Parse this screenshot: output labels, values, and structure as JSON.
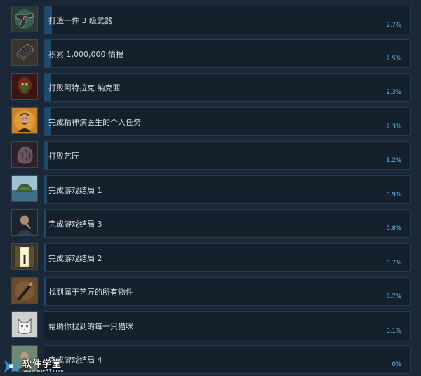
{
  "achievements": [
    {
      "name": "打造一件 3 级武器",
      "percent": "2.7%",
      "fraction": 0.027,
      "icon": "revolver-icon"
    },
    {
      "name": "积累 1,000,000 情报",
      "percent": "2.5%",
      "fraction": 0.025,
      "icon": "documents-icon"
    },
    {
      "name": "打败阿特拉克 纳克亚",
      "percent": "2.3%",
      "fraction": 0.023,
      "icon": "spider-monster-icon"
    },
    {
      "name": "完成精神病医生的个人任务",
      "percent": "2.3%",
      "fraction": 0.023,
      "icon": "doctor-portrait-icon"
    },
    {
      "name": "打败艺匠",
      "percent": "1.2%",
      "fraction": 0.012,
      "icon": "flesh-creature-icon"
    },
    {
      "name": "完成游戏结局 1",
      "percent": "0.9%",
      "fraction": 0.009,
      "icon": "island-icon"
    },
    {
      "name": "完成游戏结局 3",
      "percent": "0.8%",
      "fraction": 0.008,
      "icon": "man-portrait-icon"
    },
    {
      "name": "完成游戏结局 2",
      "percent": "0.7%",
      "fraction": 0.007,
      "icon": "doorway-light-icon"
    },
    {
      "name": "找到属于艺匠的所有物件",
      "percent": "0.7%",
      "fraction": 0.007,
      "icon": "carving-tool-icon"
    },
    {
      "name": "帮助你找到的每一只猫咪",
      "percent": "0.1%",
      "fraction": 0.001,
      "icon": "cat-icon"
    },
    {
      "name": "完成游戏结局 4",
      "percent": "0%",
      "fraction": 0.0,
      "icon": "figure-portrait-icon"
    }
  ],
  "colors": {
    "background": "#1b2838",
    "bar_background": "#14202c",
    "progress_fill": "#1f4c6e",
    "percent_text": "#66c0f4",
    "name_text": "#d6dbe0"
  },
  "watermark": {
    "title": "软件学堂",
    "url": "www.xue51.com"
  }
}
